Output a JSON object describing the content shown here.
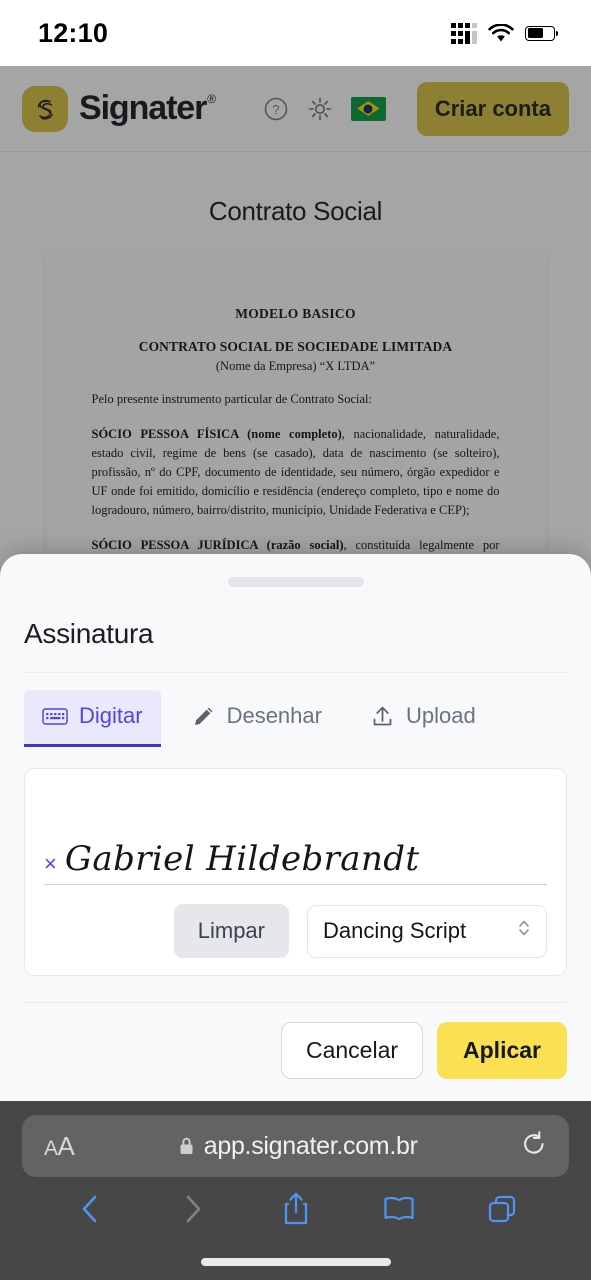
{
  "statusbar": {
    "time": "12:10",
    "cellular_icon": "cellular-signal-icon",
    "wifi_icon": "wifi-icon",
    "battery_icon": "battery-icon",
    "battery_level_pct": 62
  },
  "header": {
    "brand": "Signater",
    "trademark": "®",
    "logo_icon": "fingerprint-logo-icon",
    "help_icon": "help-circle-icon",
    "theme_icon": "sun-icon",
    "language_flag": "brazil-flag-icon",
    "cta_label": "Criar conta",
    "brand_color": "#d8c13e"
  },
  "document": {
    "title": "Contrato Social",
    "heading": "MODELO BASICO",
    "subheading": "CONTRATO SOCIAL DE SOCIEDADE LIMITADA",
    "company_line": "(Nome da Empresa) “X LTDA”",
    "intro": "Pelo presente instrumento particular de Contrato Social:",
    "clause1_bold_a": "SÓCIO PESSOA FÍSICA ",
    "clause1_bold_b": "(nome completo)",
    "clause1_rest": ", nacionalidade, naturalidade, estado civil, regime de bens (se casado), data de nascimento (se solteiro), profissão, nº do CPF, documento de identidade, seu número, órgão expedidor e UF onde foi emitido, domicílio e residência (endereço completo, tipo e nome do logradouro, número, bairro/distrito, município, Unidade Federativa e CEP);",
    "clause2_bold_a": "SÓCIO PESSOA JURÍDICA ",
    "clause2_bold_b": "(razão social)",
    "clause2_rest": ", constituída legalmente por (contrato social / estatuto social) devidamente arquivado na Junta Comercial do Estado do Rio Grande do Norte sob NIRE ______________, com sede na ________, (endereço"
  },
  "sheet": {
    "title": "Assinatura",
    "grabber": "drag-handle",
    "tabs": [
      {
        "label": "Digitar",
        "icon": "keyboard-icon",
        "active": true
      },
      {
        "label": "Desenhar",
        "icon": "pencil-icon",
        "active": false
      },
      {
        "label": "Upload",
        "icon": "upload-icon",
        "active": false
      }
    ],
    "active_tab_color": "#4f46e5",
    "signature": {
      "x_mark": "×",
      "value": "Gabriel Hildebrandt",
      "clear_label": "Limpar",
      "font_select_value": "Dancing Script",
      "font_select_icon": "chevron-updown-icon"
    },
    "cancel_label": "Cancelar",
    "apply_label": "Aplicar",
    "apply_color": "#fae052"
  },
  "safari": {
    "text_size_small": "A",
    "text_size_large": "A",
    "lock_icon": "lock-icon",
    "url": "app.signater.com.br",
    "reload_icon": "reload-icon",
    "back_icon": "chevron-left-icon",
    "forward_icon": "chevron-right-icon",
    "share_icon": "share-icon",
    "bookmarks_icon": "book-icon",
    "tabs_icon": "tabs-icon",
    "home_indicator": "home-indicator"
  }
}
